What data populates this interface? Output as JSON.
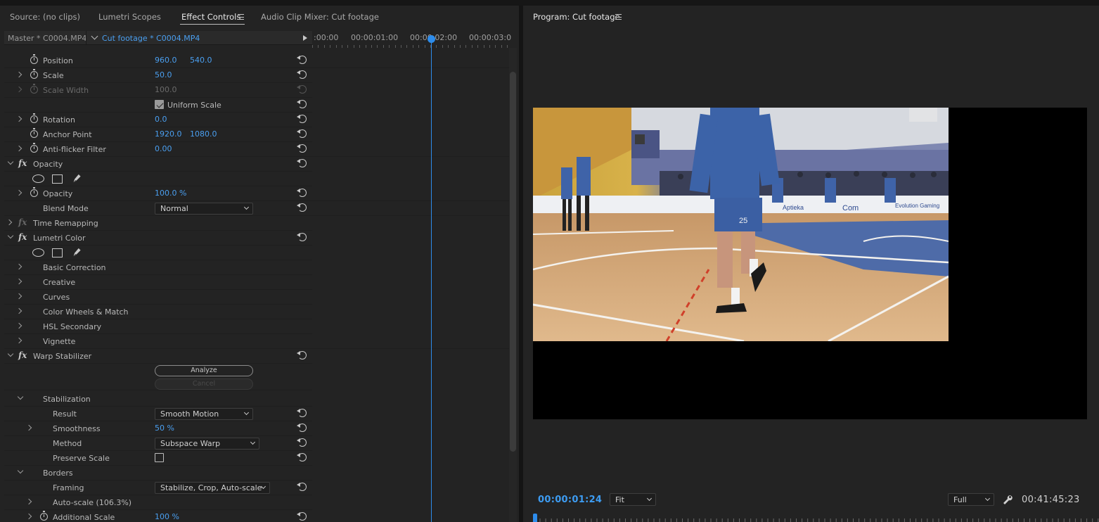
{
  "left_tabs": [
    {
      "label": "Source: (no clips)"
    },
    {
      "label": "Lumetri Scopes"
    },
    {
      "label": "Effect Controls"
    },
    {
      "label": "Audio Clip Mixer: Cut footage"
    }
  ],
  "clip_header": {
    "master": "Master * C0004.MP4",
    "active": "Cut footage * C0004.MP4"
  },
  "ruler_timecodes": [
    ":00:00",
    "00:00:01:00",
    "00:00:02:00",
    "00:00:03:0"
  ],
  "rows": {
    "position": {
      "label": "Position",
      "v1": "960.0",
      "v2": "540.0"
    },
    "scale": {
      "label": "Scale",
      "v1": "50.0"
    },
    "scale_width": {
      "label": "Scale Width",
      "v1": "100.0"
    },
    "uniform_scale": {
      "label": "Uniform Scale"
    },
    "rotation": {
      "label": "Rotation",
      "v1": "0.0"
    },
    "anchor_point": {
      "label": "Anchor Point",
      "v1": "1920.0",
      "v2": "1080.0"
    },
    "anti_flicker": {
      "label": "Anti-flicker Filter",
      "v1": "0.00"
    },
    "opacity_group": {
      "label": "Opacity"
    },
    "opacity": {
      "label": "Opacity",
      "v1": "100.0 %"
    },
    "blend_mode": {
      "label": "Blend Mode",
      "value": "Normal"
    },
    "time_remapping": {
      "label": "Time Remapping"
    },
    "lumetri_color": {
      "label": "Lumetri Color"
    },
    "basic_correction": {
      "label": "Basic Correction"
    },
    "creative": {
      "label": "Creative"
    },
    "curves": {
      "label": "Curves"
    },
    "color_wheels": {
      "label": "Color Wheels & Match"
    },
    "hsl_secondary": {
      "label": "HSL Secondary"
    },
    "vignette": {
      "label": "Vignette"
    },
    "warp_stabilizer": {
      "label": "Warp Stabilizer",
      "analyze": "Analyze",
      "cancel": "Cancel"
    },
    "stabilization": {
      "label": "Stabilization"
    },
    "result": {
      "label": "Result",
      "value": "Smooth Motion"
    },
    "smoothness": {
      "label": "Smoothness",
      "v1": "50 %"
    },
    "method": {
      "label": "Method",
      "value": "Subspace Warp"
    },
    "preserve_scale": {
      "label": "Preserve Scale"
    },
    "borders": {
      "label": "Borders"
    },
    "framing": {
      "label": "Framing",
      "value": "Stabilize, Crop, Auto-scale"
    },
    "auto_scale": {
      "label": "Auto-scale (106.3%)"
    },
    "additional_scale": {
      "label": "Additional Scale",
      "v1": "100 %"
    }
  },
  "program": {
    "title": "Program: Cut footage",
    "timecode": "00:00:01:24",
    "fit": "Fit",
    "quality": "Full",
    "duration": "00:41:45:23"
  },
  "video_signage": {
    "apteka": "Aptieka",
    "com": "Com",
    "evolution": "Evolution Gaming",
    "jersey": "25"
  },
  "colors": {
    "accent_blue": "#4a9ff0",
    "playhead": "#2d8ceb",
    "panel_bg": "#232323"
  }
}
